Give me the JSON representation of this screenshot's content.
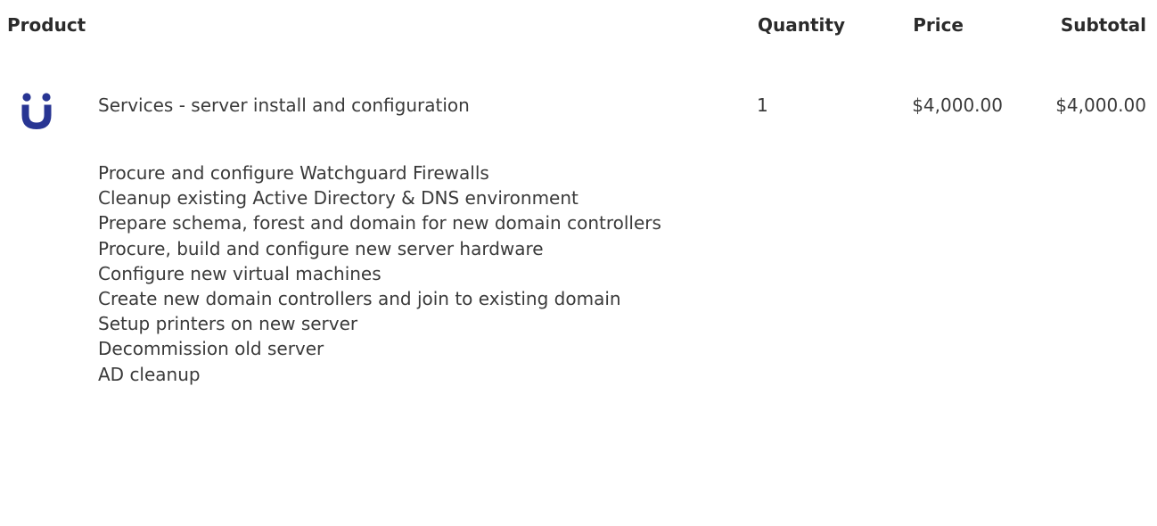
{
  "table": {
    "headers": {
      "product": "Product",
      "quantity": "Quantity",
      "price": "Price",
      "subtotal": "Subtotal"
    },
    "row": {
      "logo_icon": "u-smile-logo-icon",
      "name": "Services - server install and configuration",
      "quantity": "1",
      "price": "$4,000.00",
      "subtotal": "$4,000.00",
      "description_lines": [
        "Procure and configure Watchguard Firewalls",
        "Cleanup existing Active Directory & DNS environment",
        "Prepare schema, forest and domain for new domain controllers",
        "Procure, build and configure new server hardware",
        "Configure new virtual machines",
        "Create new domain controllers and join to existing domain",
        "Setup printers on new server",
        "Decommission old server",
        "AD cleanup"
      ]
    }
  },
  "colors": {
    "logo": "#283593",
    "text": "#3a3a3a"
  }
}
